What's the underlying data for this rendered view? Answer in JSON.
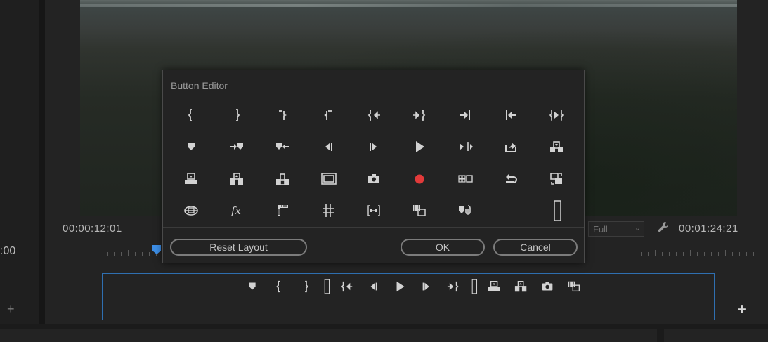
{
  "left_panel": {
    "timecode": ":00",
    "add_label": "+"
  },
  "monitor": {
    "current_timecode": "00:00:12:01",
    "duration_timecode": "00:01:24:21",
    "fit_value": "Full",
    "add_label": "+"
  },
  "dialog": {
    "title": "Button Editor",
    "reset_label": "Reset Layout",
    "ok_label": "OK",
    "cancel_label": "Cancel",
    "rows": [
      [
        "mark-in-icon",
        "mark-out-icon",
        "clear-in-icon",
        "clear-out-icon",
        "go-to-in-icon",
        "go-to-out-icon",
        "go-to-next-edit-icon",
        "go-to-previous-edit-icon",
        "play-in-to-out-icon"
      ],
      [
        "add-marker-icon",
        "go-to-next-marker-icon",
        "go-to-previous-marker-icon",
        "step-back-icon",
        "step-forward-icon",
        "play-stop-icon",
        "play-around-icon",
        "export-frame-share-icon",
        "overwrite-icon"
      ],
      [
        "lift-icon",
        "extract-icon",
        "insert-icon",
        "safe-margins-icon",
        "export-frame-icon",
        "record-icon",
        "multi-camera-icon",
        "loop-icon",
        "comparison-view-icon"
      ],
      [
        "vr-video-icon",
        "fx-toggle-icon",
        "show-rulers-icon",
        "show-guides-icon",
        "snap-in-program-monitor-icon",
        "toggle-proxies-icon",
        "link-marker-icon",
        "",
        "spacer-icon"
      ]
    ]
  },
  "button_bar": {
    "items": [
      "add-marker-icon",
      "mark-in-icon",
      "mark-out-icon",
      "spacer-icon",
      "go-to-in-icon",
      "step-back-icon",
      "play-stop-icon",
      "step-forward-icon",
      "go-to-out-icon",
      "spacer-icon",
      "lift-icon",
      "extract-icon",
      "export-frame-icon",
      "toggle-proxies-icon"
    ]
  },
  "colors": {
    "accent_blue": "#2f6fb0",
    "record_red": "#e23a3a",
    "playhead_blue": "#3d8ee6"
  }
}
